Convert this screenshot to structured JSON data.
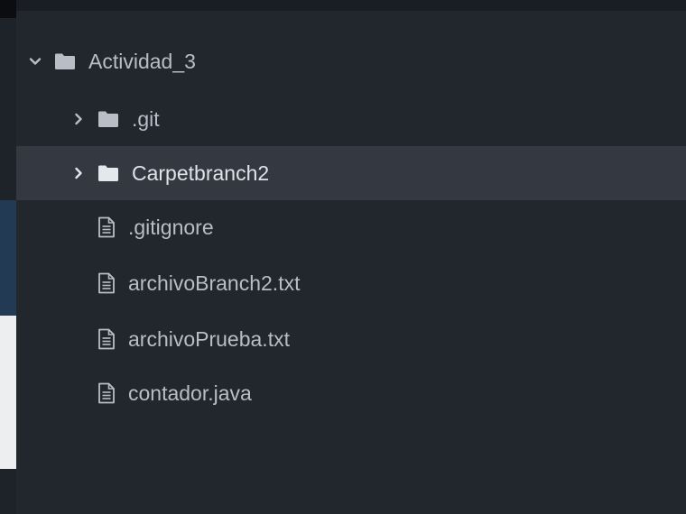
{
  "tree": {
    "root": {
      "label": "Actividad_3",
      "expanded": true,
      "icon": "folder-icon"
    },
    "items": [
      {
        "label": ".git",
        "kind": "folder",
        "expanded": false,
        "selected": false,
        "icon": "folder-icon"
      },
      {
        "label": "Carpetbranch2",
        "kind": "folder",
        "expanded": false,
        "selected": true,
        "icon": "folder-icon"
      },
      {
        "label": ".gitignore",
        "kind": "file",
        "selected": false,
        "icon": "file-icon"
      },
      {
        "label": "archivoBranch2.txt",
        "kind": "file",
        "selected": false,
        "icon": "file-icon"
      },
      {
        "label": "archivoPrueba.txt",
        "kind": "file",
        "selected": false,
        "icon": "file-icon"
      },
      {
        "label": "contador.java",
        "kind": "file",
        "selected": false,
        "icon": "file-icon"
      }
    ]
  },
  "colors": {
    "background": "#22262d",
    "selected_row": "#343840",
    "text": "#b8bec8",
    "folder": "#b9bec6",
    "folder_selected": "#e4e7eb"
  }
}
